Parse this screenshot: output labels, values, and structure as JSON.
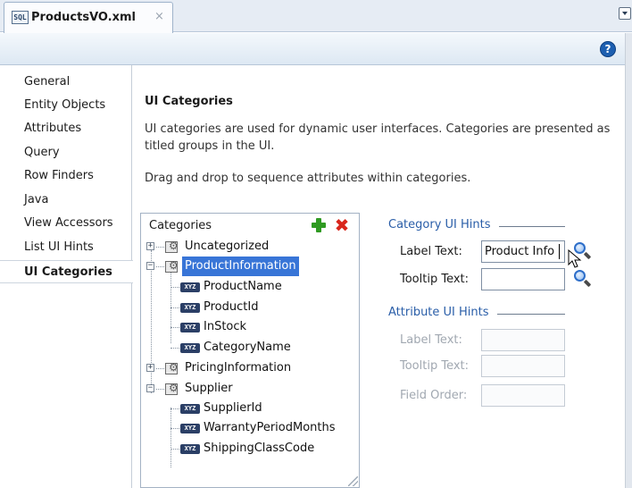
{
  "editor_tab": {
    "icon_text": "SQL",
    "title": "ProductsVO.xml",
    "close_glyph": "×",
    "dropdown_icon": "chevron-down-icon"
  },
  "help": {
    "glyph": "?",
    "icon": "help-icon"
  },
  "nav": {
    "items": [
      {
        "label": "General"
      },
      {
        "label": "Entity Objects"
      },
      {
        "label": "Attributes"
      },
      {
        "label": "Query"
      },
      {
        "label": "Row Finders"
      },
      {
        "label": "Java"
      },
      {
        "label": "View Accessors"
      },
      {
        "label": "List UI Hints"
      },
      {
        "label": "UI Categories",
        "active": true
      }
    ]
  },
  "page": {
    "title": "UI Categories",
    "description": "UI categories are used for dynamic user interfaces. Categories are presented as titled groups in the UI.",
    "drag_hint": "Drag and drop to sequence attributes within categories."
  },
  "categories": {
    "header": "Categories",
    "add_icon": "add-icon",
    "delete_icon": "delete-icon",
    "delete_glyph": "✖",
    "attribute_badge": "XYZ",
    "tree": [
      {
        "label": "Uncategorized",
        "expanded": false,
        "children": []
      },
      {
        "label": "ProductInformation",
        "expanded": true,
        "selected": true,
        "children": [
          "ProductName",
          "ProductId",
          "InStock",
          "CategoryName"
        ]
      },
      {
        "label": "PricingInformation",
        "expanded": false,
        "children": []
      },
      {
        "label": "Supplier",
        "expanded": true,
        "children": [
          "SupplierId",
          "WarrantyPeriodMonths",
          "ShippingClassCode"
        ]
      }
    ]
  },
  "category_hints": {
    "title": "Category UI Hints",
    "label_text_label": "Label Text:",
    "label_text_value": "Product Info",
    "tooltip_text_label": "Tooltip Text:",
    "tooltip_text_value": ""
  },
  "attribute_hints": {
    "title": "Attribute UI Hints",
    "label_text_label": "Label Text:",
    "tooltip_text_label": "Tooltip Text:",
    "field_order_label": "Field Order:",
    "enabled": false
  },
  "colors": {
    "selection": "#3875d7",
    "group_title": "#2a5ea8",
    "add_green": "#2f9a22",
    "delete_red": "#d9261c",
    "tab_strip": "#e6ecf4"
  }
}
